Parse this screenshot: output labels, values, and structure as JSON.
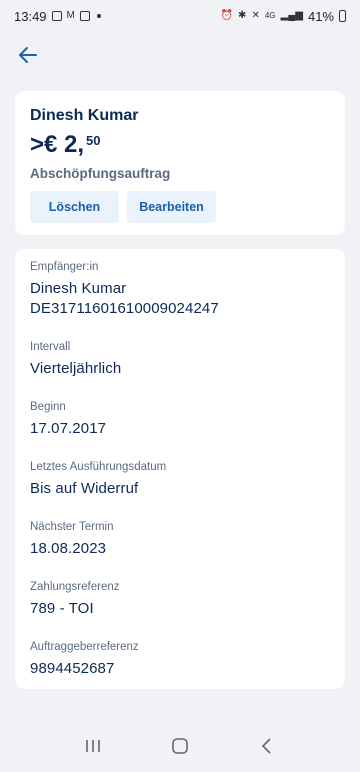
{
  "status_bar": {
    "time": "13:49",
    "network": "4G",
    "battery": "41%"
  },
  "header": {
    "back_icon": "arrow-left-icon"
  },
  "summary": {
    "name": "Dinesh Kumar",
    "amount_main": ">€ 2,",
    "amount_cents": "50",
    "type": "Abschöpfungsauftrag",
    "delete_label": "Löschen",
    "edit_label": "Bearbeiten"
  },
  "details": [
    {
      "label": "Empfänger:in",
      "value": "Dinesh Kumar",
      "value2": "DE31711601610009024247"
    },
    {
      "label": "Intervall",
      "value": "Vierteljährlich"
    },
    {
      "label": "Beginn",
      "value": "17.07.2017"
    },
    {
      "label": "Letztes Ausführungsdatum",
      "value": "Bis auf Widerruf"
    },
    {
      "label": "Nächster Termin",
      "value": "18.08.2023"
    },
    {
      "label": "Zahlungsreferenz",
      "value": "789 - TOI"
    },
    {
      "label": "Auftraggeberreferenz",
      "value": "9894452687"
    }
  ],
  "colors": {
    "accent": "#1b5fb0",
    "text_primary": "#0b2a55",
    "text_secondary": "#5b6b82",
    "background": "#f0f2f6"
  }
}
